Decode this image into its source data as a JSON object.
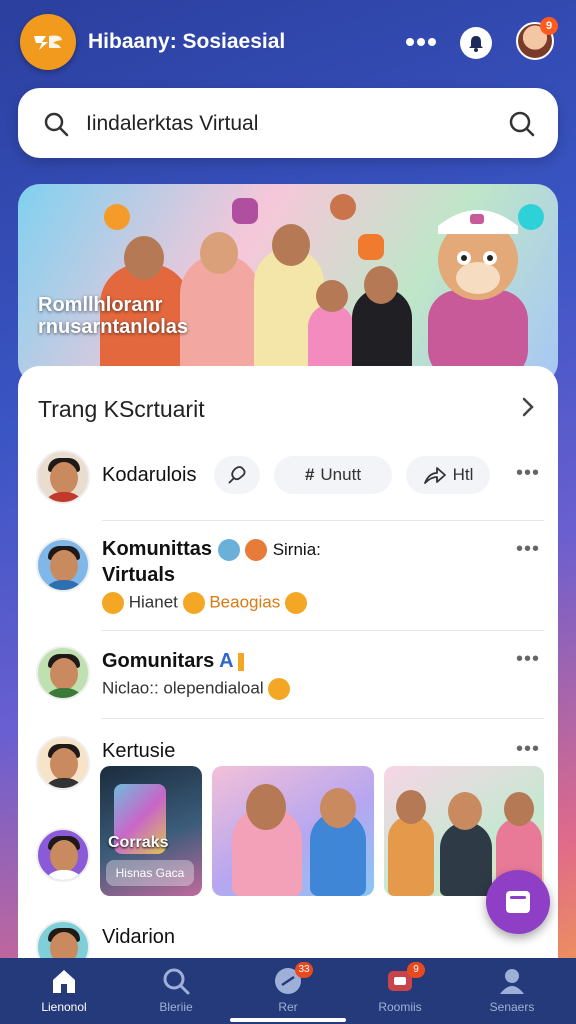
{
  "header": {
    "app_title": "Hibaany: Sosiaesial",
    "notification_count": "9",
    "icons": [
      "app-logo-icon",
      "menu-dots-icon",
      "bell-icon",
      "profile-avatar"
    ]
  },
  "search": {
    "value": "Iindalerktas Virtual"
  },
  "banner": {
    "text": "Romllhloranr rnusarntanlolas"
  },
  "feed": {
    "section_title": "Trang KScrtuarit",
    "items": [
      {
        "name": "Kodarulois",
        "actions": [
          {
            "label": "",
            "icon": "pin-icon"
          },
          {
            "label": "Unutt",
            "icon": "hashtag-icon"
          },
          {
            "label": "Htl",
            "icon": "share-icon"
          }
        ]
      },
      {
        "name": "Komunittas",
        "name_suffix": "Sirnia:",
        "name_line2": "Virtuals",
        "sub_left": "Hianet",
        "sub_right": "Beaogias"
      },
      {
        "name": "Gomunitars",
        "name_suffix": "A",
        "sub": "Niclao:: olependialoal"
      },
      {
        "name": "Kertusie",
        "thumbs": [
          {
            "label": "Corraks",
            "chip": "Hisnas  Gaca"
          },
          {
            "label": ""
          },
          {
            "label": ""
          }
        ]
      },
      {
        "name": "Vidarion"
      }
    ]
  },
  "bottom_nav": {
    "items": [
      {
        "label": "Lienonol",
        "icon": "home-icon",
        "badge": ""
      },
      {
        "label": "Bleriie",
        "icon": "search-icon",
        "badge": ""
      },
      {
        "label": "Rer",
        "icon": "chat-icon",
        "badge": "33"
      },
      {
        "label": "Roomiis",
        "icon": "rooms-icon",
        "badge": "9"
      },
      {
        "label": "Senaers",
        "icon": "profile-icon",
        "badge": ""
      }
    ]
  },
  "colors": {
    "accent": "#f29a1d",
    "fab": "#8e3fc6",
    "nav_bg": "#243a7a",
    "badge": "#e84a1f"
  }
}
